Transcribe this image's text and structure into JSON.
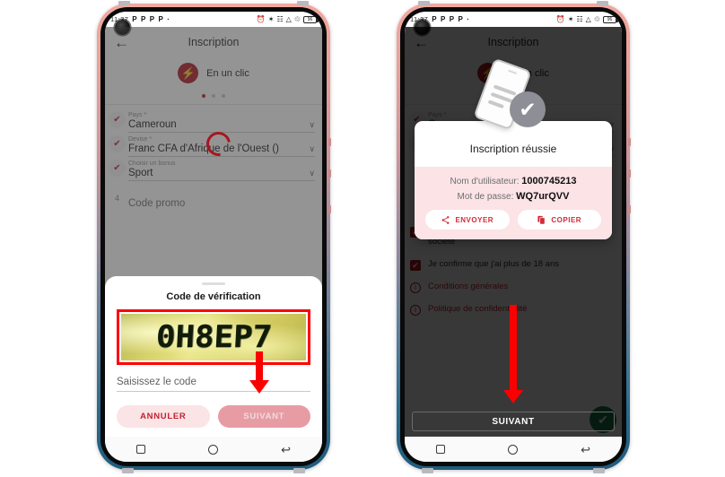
{
  "statusbar": {
    "time": "11:37",
    "left_icons": [
      "P",
      "P",
      "P",
      "P",
      "·"
    ],
    "right_icons": [
      "alarm-icon",
      "bluetooth-icon",
      "vpn-icon",
      "signal-icon",
      "signal2-icon",
      "nfc-icon"
    ],
    "battery_label": "96"
  },
  "appbar": {
    "back": "←",
    "title": "Inscription"
  },
  "brand": {
    "icon": "⚡",
    "label": "En un clic"
  },
  "pager": {
    "total": 3,
    "active": 0
  },
  "form": {
    "rows": [
      {
        "marker": "✔",
        "label": "Pays *",
        "value": "Cameroun",
        "caret": "∨"
      },
      {
        "marker": "✔",
        "label": "Devise *",
        "value": "Franc CFA d'Afrique de l'Ouest ()",
        "caret": "∨"
      },
      {
        "marker": "✔",
        "label": "Choisir un bonus",
        "value": "Sport",
        "caret": "∨"
      },
      {
        "marker": "4",
        "label": "",
        "value": "Code promo",
        "caret": ""
      }
    ]
  },
  "consents": [
    {
      "type": "checkbox",
      "mark": "✔",
      "text": "J'accepte la Politique de confidentialité de la société"
    },
    {
      "type": "checkbox",
      "mark": "✔",
      "text": "Je confirme que j'ai plus de 18 ans"
    },
    {
      "type": "info",
      "mark": "i",
      "text": "Conditions générales"
    },
    {
      "type": "info",
      "mark": "i",
      "text": "Politique de confidentialité"
    }
  ],
  "next_bar": {
    "label": "SUIVANT",
    "fab_icon": "✔"
  },
  "navbar": {
    "recents": "square-icon",
    "home": "circle-icon",
    "back": "↩"
  },
  "captcha_sheet": {
    "title": "Code de vérification",
    "captcha_text": "0H8EP7",
    "input_placeholder": "Saisissez le code",
    "cancel_label": "ANNULER",
    "next_label": "SUIVANT"
  },
  "success_dialog": {
    "title": "Inscription réussie",
    "username_label": "Nom d'utilisateur:",
    "username_value": "1000745213",
    "password_label": "Mot de passe:",
    "password_value": "WQ7urQVV",
    "send_label": "ENVOYER",
    "copy_label": "COPIER",
    "send_icon": "share-icon",
    "copy_icon": "copy-icon",
    "check_icon": "✔"
  },
  "annotations": {
    "captcha_highlight_color": "#ff0000",
    "arrow_color": "#fb0000"
  },
  "theme": {
    "brand_red": "#b21b26",
    "accent_red": "#c2202e",
    "pink_bg": "#fbe3e6",
    "green": "#1f7a46"
  }
}
